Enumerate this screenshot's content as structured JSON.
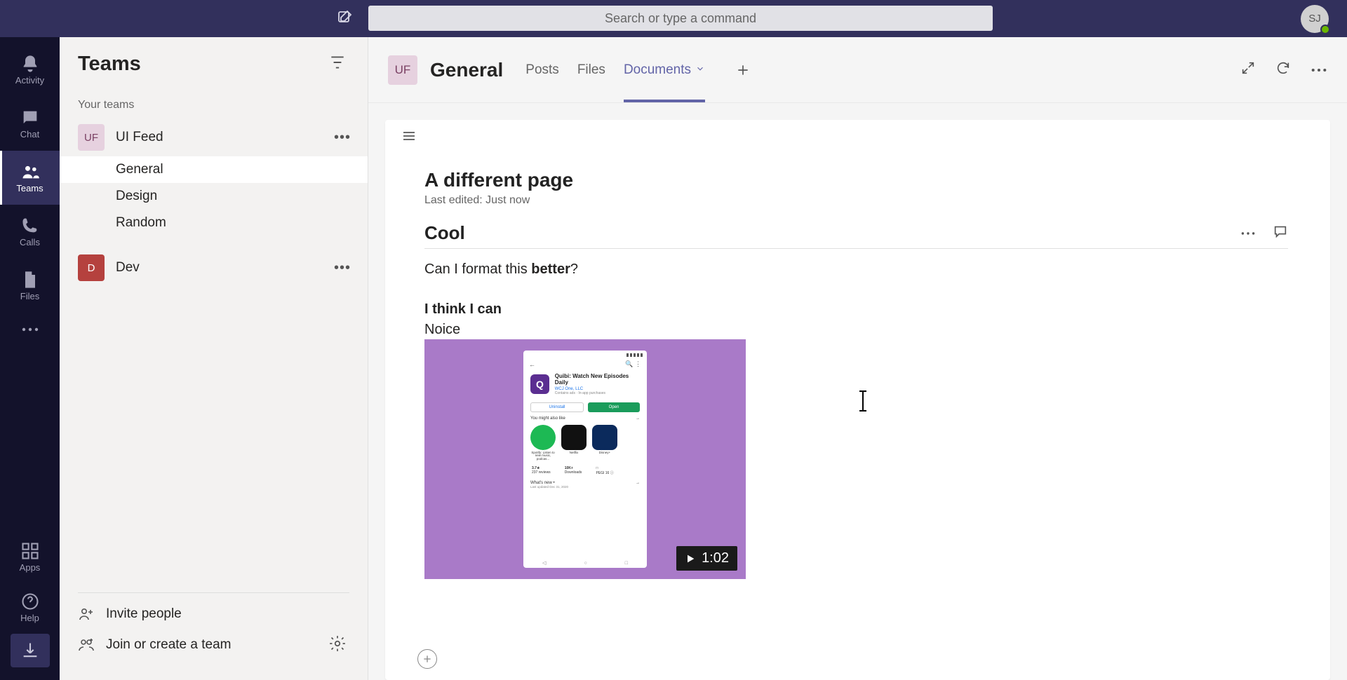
{
  "search": {
    "placeholder": "Search or type a command"
  },
  "user": {
    "initials": "SJ"
  },
  "rail": {
    "activity": "Activity",
    "chat": "Chat",
    "teams": "Teams",
    "calls": "Calls",
    "files": "Files",
    "apps": "Apps",
    "help": "Help"
  },
  "sidebar": {
    "title": "Teams",
    "section": "Your teams",
    "teams": [
      {
        "badge": "UF",
        "name": "UI Feed",
        "channels": [
          {
            "name": "General",
            "active": true
          },
          {
            "name": "Design",
            "active": false
          },
          {
            "name": "Random",
            "active": false
          }
        ]
      },
      {
        "badge": "D",
        "name": "Dev",
        "channels": []
      }
    ],
    "invite": "Invite people",
    "join": "Join or create a team"
  },
  "header": {
    "badge": "UF",
    "channel": "General",
    "tabs": [
      {
        "label": "Posts",
        "active": false,
        "dropdown": false
      },
      {
        "label": "Files",
        "active": false,
        "dropdown": false
      },
      {
        "label": "Documents",
        "active": true,
        "dropdown": true
      }
    ]
  },
  "doc": {
    "title": "A different page",
    "meta": "Last edited: Just now",
    "section_heading": "Cool",
    "paragraph_prefix": "Can I format this ",
    "paragraph_bold": "better",
    "paragraph_suffix": "?",
    "bold_line": "I think I can",
    "plain_line": "Noice",
    "video_duration": "1:02",
    "phone": {
      "app_title": "Quibi: Watch New Episodes Daily",
      "publisher": "WCJ One, LLC",
      "contains": "Contains ads · In-app purchases",
      "uninstall": "Uninstall",
      "open": "Open",
      "yml": "You might also like",
      "suggested": [
        {
          "name": "Spotify: Listen to new music, podcas...",
          "color": "#1db954"
        },
        {
          "name": "Netflix",
          "color": "#111"
        },
        {
          "name": "Disney+",
          "color": "#0b2a5c"
        }
      ],
      "stat1_top": "3.7★",
      "stat1_bot": "237 reviews",
      "stat2_top": "10K+",
      "stat2_bot": "Downloads",
      "stat3_top": "□",
      "stat3_bot": "PEGI 16 ⓘ",
      "whatsnew": "What's new  •",
      "updated": "Last updated Dec 31, 2020"
    }
  }
}
